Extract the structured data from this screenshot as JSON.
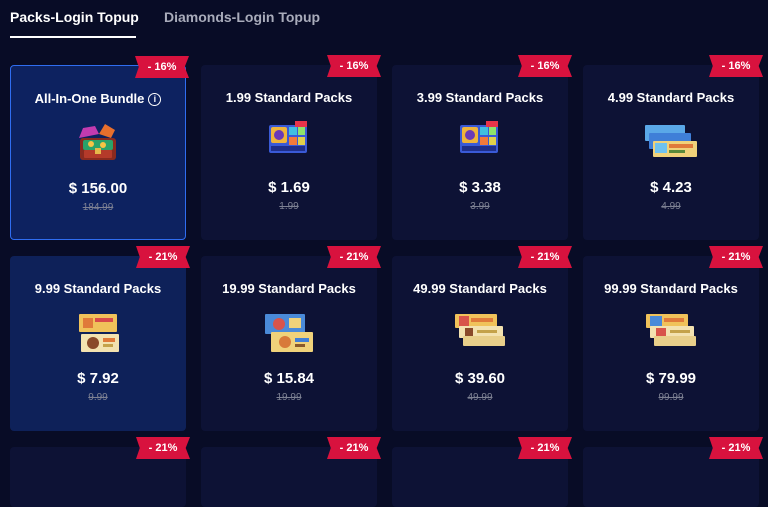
{
  "tabs": [
    {
      "label": "Packs-Login Topup",
      "active": true
    },
    {
      "label": "Diamonds-Login Topup",
      "active": false
    }
  ],
  "products": [
    {
      "title": "All-In-One Bundle",
      "price": "$ 156.00",
      "original": "184.99",
      "discount": "- 16%",
      "image": "treasure-chest-icon"
    },
    {
      "title": "1.99 Standard Packs",
      "price": "$ 1.69",
      "original": "1.99",
      "discount": "- 16%",
      "image": "pack-card-icon"
    },
    {
      "title": "3.99 Standard Packs",
      "price": "$ 3.38",
      "original": "3.99",
      "discount": "- 16%",
      "image": "pack-card-icon"
    },
    {
      "title": "4.99 Standard Packs",
      "price": "$ 4.23",
      "original": "4.99",
      "discount": "- 16%",
      "image": "pack-stack-icon"
    },
    {
      "title": "9.99 Standard Packs",
      "price": "$ 7.92",
      "original": "9.99",
      "discount": "- 21%",
      "image": "pack-stack-icon"
    },
    {
      "title": "19.99 Standard Packs",
      "price": "$ 15.84",
      "original": "19.99",
      "discount": "- 21%",
      "image": "pack-stack-icon"
    },
    {
      "title": "49.99 Standard Packs",
      "price": "$ 39.60",
      "original": "49.99",
      "discount": "- 21%",
      "image": "pack-stack-icon"
    },
    {
      "title": "99.99 Standard Packs",
      "price": "$ 79.99",
      "original": "99.99",
      "discount": "- 21%",
      "image": "pack-stack-icon"
    },
    {
      "discount": "- 21%"
    },
    {
      "discount": "- 21%"
    },
    {
      "discount": "- 21%"
    },
    {
      "discount": "- 21%"
    }
  ],
  "info_icon": "info-icon",
  "colors": {
    "background": "#080c26",
    "card": "#0d1235",
    "card_highlight": "#0e2159",
    "selected_border": "#2f6df0",
    "badge": "#d8123e"
  }
}
